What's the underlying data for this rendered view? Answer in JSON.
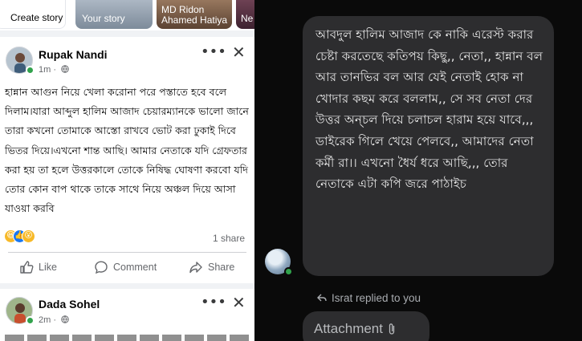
{
  "stories": {
    "create": "Create story",
    "yours": "Your story",
    "ridon": "MD Ridon Ahamed Hatiya",
    "ne": "Ne"
  },
  "post1": {
    "author": "Rupak Nandi",
    "time": "1m",
    "text": "হান্নান আগুন নিয়ে খেলা করোনা পরে পস্তাতে হবে বলে দিলাম।যারা আব্দুল হালিম আজাদ চেয়ারম্যানকে ভালো জানে তারা কখনো তোমাকে আস্তো রাখবে ভোট করা ঢুকাই দিবে ভিতর দিয়ে।এখনো শান্ত আছি। আমার নেতাকে যদি গ্রেফতার করা হয় তা হলে উত্তরকালে তোকে নিষিদ্ধ ঘোষণা করবো যদি তোর কোন বাপ থাকে তাকে সাথে নিয়ে অঞ্চল দিয়ে আসা যাওয়া করবি",
    "shares": "1 share",
    "actions": {
      "like": "Like",
      "comment": "Comment",
      "share": "Share"
    }
  },
  "post2": {
    "author": "Dada Sohel",
    "time": "2m"
  },
  "chat": {
    "message": "আবদুল হালিম আজাদ কে নাকি এরেস্ট করার চেষ্টা করতেছে কতিপয় কিছু,, নেতা,, হান্নান বল আর তানভির বল আর যেই নেতাই হোক না খোদার কছম করে বললাম,, সে সব নেতা দের উত্তর অন্চল দিয়ে চলাচল হারাম হয়ে যাবে,,, ডাইরেক গিলে খেয়ে পেলবে,, আমাদের নেতা কর্মী রা।। এখনো ধৈর্য ধরে আছি,,, তোর নেতাকে এটা কপি জরে পাঠাইচ",
    "reply_note": "Israt replied to you",
    "attachment": "Attachment"
  },
  "colors": {
    "fb_blue": "#1877f2",
    "online_green": "#31a24c",
    "bubble_dark": "#2d2d2f"
  },
  "icons": [
    "globe-icon",
    "more-options-icon",
    "close-icon",
    "like-icon",
    "comment-icon",
    "share-icon",
    "reply-arrow-icon",
    "paperclip-icon"
  ]
}
